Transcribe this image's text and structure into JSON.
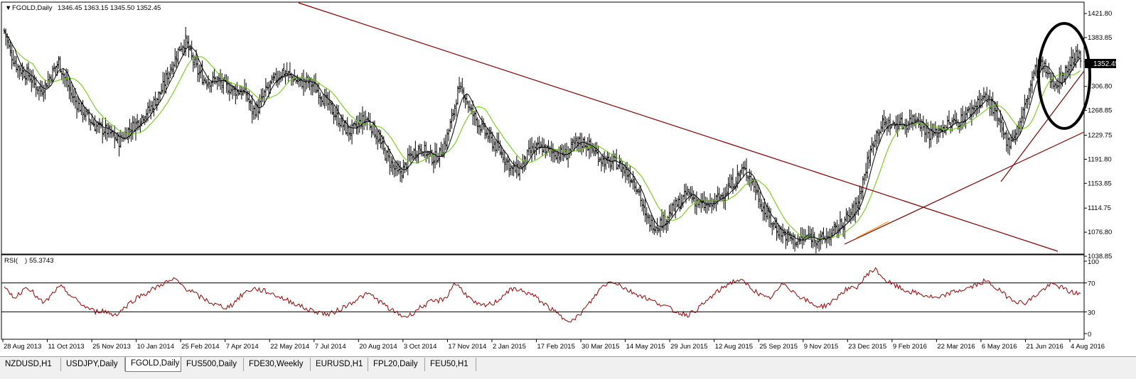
{
  "main_panel": {
    "header": {
      "symbol": "FGOLD,Daily",
      "ohlc": "1346.45 1363.15 1345.50 1352.45"
    },
    "current_price": "1352.45",
    "y_ticks": [
      "1421.80",
      "1383.85",
      "1345.75",
      "1306.80",
      "1268.85",
      "1229.75",
      "1191.80",
      "1153.85",
      "1114.75",
      "1076.80",
      "1038.85"
    ]
  },
  "rsi_panel": {
    "label": "RSI(",
    "label_close": ")",
    "value": "55.3743",
    "y_ticks": [
      "100",
      "70",
      "30",
      "0"
    ],
    "levels": [
      70,
      30
    ]
  },
  "x_ticks": [
    "28 Aug 2013",
    "11 Oct 2013",
    "25 Nov 2013",
    "10 Jan 2014",
    "25 Feb 2014",
    "7 Apr 2014",
    "22 May 2014",
    "7 Jul 2014",
    "20 Aug 2014",
    "3 Oct 2014",
    "17 Nov 2014",
    "2 Jan 2015",
    "17 Feb 2015",
    "30 Mar 2015",
    "14 May 2015",
    "29 Jun 2015",
    "12 Aug 2015",
    "25 Sep 2015",
    "9 Nov 2015",
    "23 Dec 2015",
    "9 Feb 2016",
    "22 Mar 2016",
    "6 May 2016",
    "21 Jun 2016",
    "4 Aug 2016"
  ],
  "tabs": [
    {
      "label": "NZDUSD,H1",
      "active": false
    },
    {
      "label": "USDJPY,Daily",
      "active": false
    },
    {
      "label": "FGOLD,Daily",
      "active": true
    },
    {
      "label": "FUS500,Daily",
      "active": false
    },
    {
      "label": "FDE30,Weekly",
      "active": false
    },
    {
      "label": "EURUSD,H1",
      "active": false
    },
    {
      "label": "FPL20,Daily",
      "active": false
    },
    {
      "label": "FEU50,H1",
      "active": false
    }
  ],
  "colors": {
    "bars": "#000000",
    "ma_fast": "#000000",
    "ma_slow": "#66cc00",
    "trendline": "#800000",
    "rsi_line": "#990000",
    "ellipse": "#000000",
    "price_label_bg": "#000000",
    "price_label_text": "#ffffff"
  },
  "chart_data": [
    {
      "type": "line",
      "title": "FGOLD,Daily",
      "x_start": "28 Aug 2013",
      "x_end": "4 Aug 2016",
      "ylim": [
        1038.85,
        1421.8
      ],
      "series": [
        {
          "values": [
            1395,
            1360,
            1340,
            1330,
            1325,
            1310,
            1300,
            1312,
            1330,
            1345,
            1320,
            1295,
            1280,
            1268,
            1255,
            1245,
            1240,
            1236,
            1228,
            1220,
            1232,
            1242,
            1250,
            1262,
            1270,
            1285,
            1300,
            1325,
            1345,
            1368,
            1378,
            1352,
            1330,
            1318,
            1315,
            1318,
            1310,
            1305,
            1300,
            1300,
            1295,
            1268,
            1272,
            1295,
            1310,
            1320,
            1330,
            1325,
            1318,
            1312,
            1315,
            1308,
            1298,
            1285,
            1272,
            1258,
            1245,
            1235,
            1240,
            1252,
            1255,
            1240,
            1220,
            1200,
            1185,
            1168,
            1175,
            1195,
            1205,
            1210,
            1200,
            1193,
            1200,
            1220,
            1255,
            1298,
            1298,
            1270,
            1255,
            1240,
            1228,
            1215,
            1205,
            1190,
            1175,
            1175,
            1188,
            1205,
            1208,
            1210,
            1205,
            1202,
            1200,
            1200,
            1212,
            1218,
            1218,
            1210,
            1200,
            1190,
            1185,
            1188,
            1180,
            1170,
            1160,
            1140,
            1100,
            1090,
            1088,
            1095,
            1105,
            1118,
            1125,
            1140,
            1130,
            1120,
            1118,
            1120,
            1130,
            1138,
            1150,
            1160,
            1175,
            1170,
            1150,
            1125,
            1105,
            1090,
            1080,
            1072,
            1068,
            1062,
            1066,
            1070,
            1068,
            1065,
            1068,
            1075,
            1085,
            1095,
            1105,
            1118,
            1158,
            1195,
            1228,
            1245,
            1248,
            1245,
            1250,
            1245,
            1255,
            1258,
            1242,
            1232,
            1232,
            1242,
            1245,
            1250,
            1252,
            1262,
            1270,
            1282,
            1290,
            1282,
            1260,
            1235,
            1218,
            1230,
            1250,
            1282,
            1320,
            1342,
            1335,
            1318,
            1312,
            1322,
            1338,
            1355,
            1352
          ]
        }
      ]
    },
    {
      "type": "line",
      "title": "RSI",
      "ylim": [
        0,
        100
      ],
      "levels": [
        70,
        30
      ],
      "series": [
        {
          "values": [
            62,
            55,
            50,
            58,
            66,
            57,
            47,
            42,
            50,
            60,
            64,
            58,
            50,
            44,
            38,
            34,
            30,
            32,
            30,
            26,
            28,
            35,
            42,
            48,
            53,
            56,
            61,
            65,
            70,
            72,
            75,
            68,
            62,
            58,
            52,
            48,
            44,
            40,
            38,
            36,
            40,
            48,
            55,
            60,
            62,
            60,
            58,
            55,
            52,
            48,
            45,
            42,
            38,
            34,
            32,
            30,
            28,
            26,
            30,
            34,
            38,
            43,
            48,
            52,
            55,
            50,
            44,
            38,
            32,
            28,
            24,
            24,
            30,
            36,
            40,
            44,
            45,
            47,
            54,
            70,
            64,
            55,
            46,
            40,
            38,
            40,
            42,
            48,
            56,
            60,
            62,
            58,
            56,
            52,
            46,
            40,
            34,
            28,
            22,
            20,
            18,
            26,
            35,
            44,
            55,
            65,
            70,
            72,
            68,
            62,
            58,
            55,
            52,
            48,
            44,
            42,
            38,
            34,
            30,
            28,
            26,
            30,
            36,
            42,
            50,
            56,
            62,
            68,
            72,
            74,
            70,
            64,
            58,
            52,
            48,
            52,
            62,
            70,
            62,
            55,
            50,
            45,
            40,
            38,
            38,
            42,
            48,
            56,
            62,
            62,
            66,
            76,
            86,
            88,
            80,
            72,
            68,
            64,
            60,
            58,
            56,
            54,
            52,
            50,
            48,
            52,
            56,
            58,
            60,
            62,
            65,
            68,
            72,
            70,
            64,
            58,
            52,
            48,
            44,
            42,
            46,
            52,
            58,
            64,
            68,
            66,
            62,
            58,
            56,
            55.37
          ]
        }
      ]
    }
  ]
}
